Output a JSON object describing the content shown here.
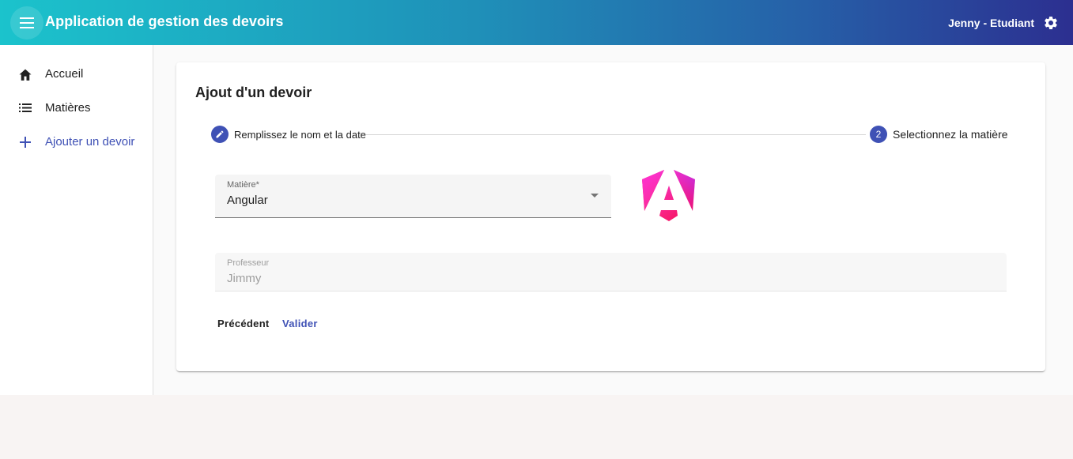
{
  "header": {
    "title": "Application de gestion des devoirs",
    "user": "Jenny - Etudiant",
    "menu_icon": "menu-icon",
    "settings_icon": "gear-icon"
  },
  "sidebar": {
    "items": [
      {
        "label": "Accueil",
        "icon": "home-icon"
      },
      {
        "label": "Matières",
        "icon": "list-icon"
      },
      {
        "label": "Ajouter un devoir",
        "icon": "plus-icon",
        "active": true
      }
    ]
  },
  "card": {
    "title": "Ajout d'un devoir",
    "steps": [
      {
        "label": "Remplissez le nom et la date",
        "icon": "edit-icon",
        "state": "done"
      },
      {
        "label": "Selectionnez la matière",
        "number": "2",
        "state": "current"
      }
    ],
    "matiere_field": {
      "label": "Matière*",
      "value": "Angular"
    },
    "professeur_field": {
      "label": "Professeur",
      "value": "Jimmy"
    },
    "subject_logo": "angular-logo",
    "buttons": {
      "previous": "Précédent",
      "validate": "Valider"
    }
  },
  "colors": {
    "primary": "#3f51b5",
    "header_gradient_start": "#1bc3cc",
    "header_gradient_end": "#2c2f90"
  }
}
